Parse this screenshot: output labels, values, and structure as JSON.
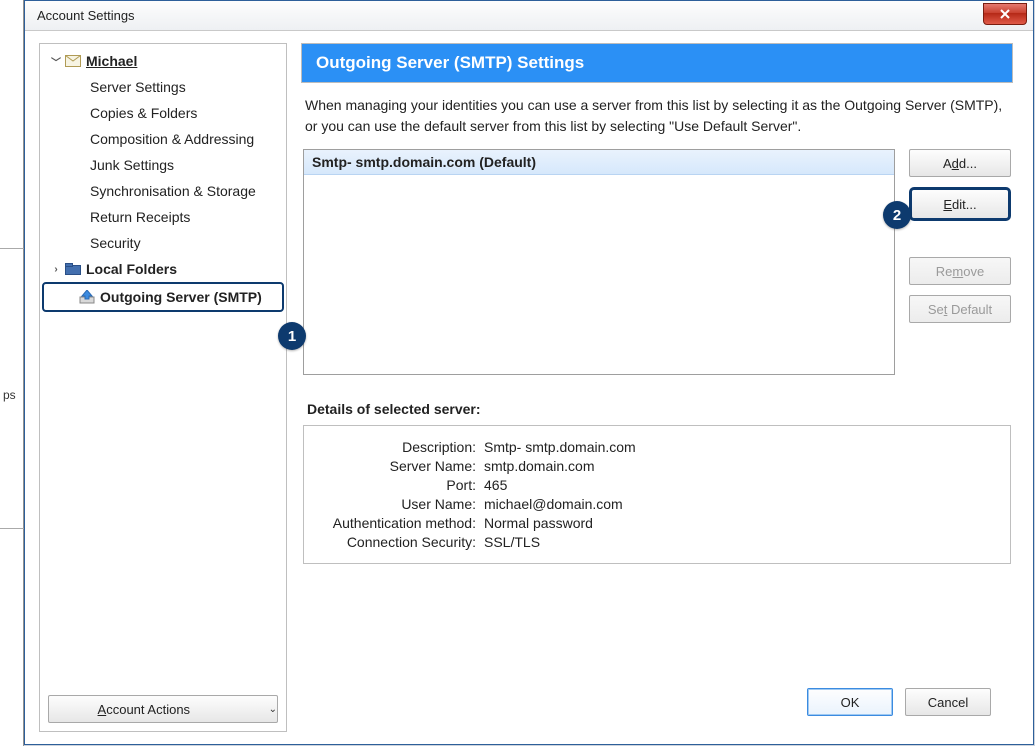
{
  "window": {
    "title": "Account Settings"
  },
  "sidebar": {
    "account_name": "Michael",
    "items": [
      "Server Settings",
      "Copies & Folders",
      "Composition & Addressing",
      "Junk Settings",
      "Synchronisation & Storage",
      "Return Receipts",
      "Security"
    ],
    "local_folders": "Local Folders",
    "outgoing": "Outgoing Server (SMTP)",
    "account_actions": "Account Actions"
  },
  "badges": {
    "b1": "1",
    "b2": "2"
  },
  "main": {
    "title": "Outgoing Server (SMTP) Settings",
    "intro": "When managing your identities you can use a server from this list by selecting it as the Outgoing Server (SMTP), or you can use the default server from this list by selecting \"Use Default Server\".",
    "server_item": "Smtp- smtp.domain.com (Default)",
    "buttons": {
      "add_pre": "A",
      "add_mid": "d",
      "add_post": "d...",
      "edit_pre": "",
      "edit_mid": "E",
      "edit_post": "dit...",
      "remove_pre": "Re",
      "remove_mid": "m",
      "remove_post": "ove",
      "default_pre": "Se",
      "default_mid": "t",
      "default_post": " Default"
    },
    "details_title": "Details of selected server:",
    "details": {
      "description_l": "Description:",
      "description_v": "Smtp- smtp.domain.com",
      "server_l": "Server Name:",
      "server_v": "smtp.domain.com",
      "port_l": "Port:",
      "port_v": "465",
      "user_l": "User Name:",
      "user_v": "michael@domain.com",
      "auth_l": "Authentication method:",
      "auth_v": "Normal password",
      "sec_l": "Connection Security:",
      "sec_v": "SSL/TLS"
    }
  },
  "footer": {
    "ok": "OK",
    "cancel": "Cancel"
  },
  "accent": "#0d3a6e"
}
